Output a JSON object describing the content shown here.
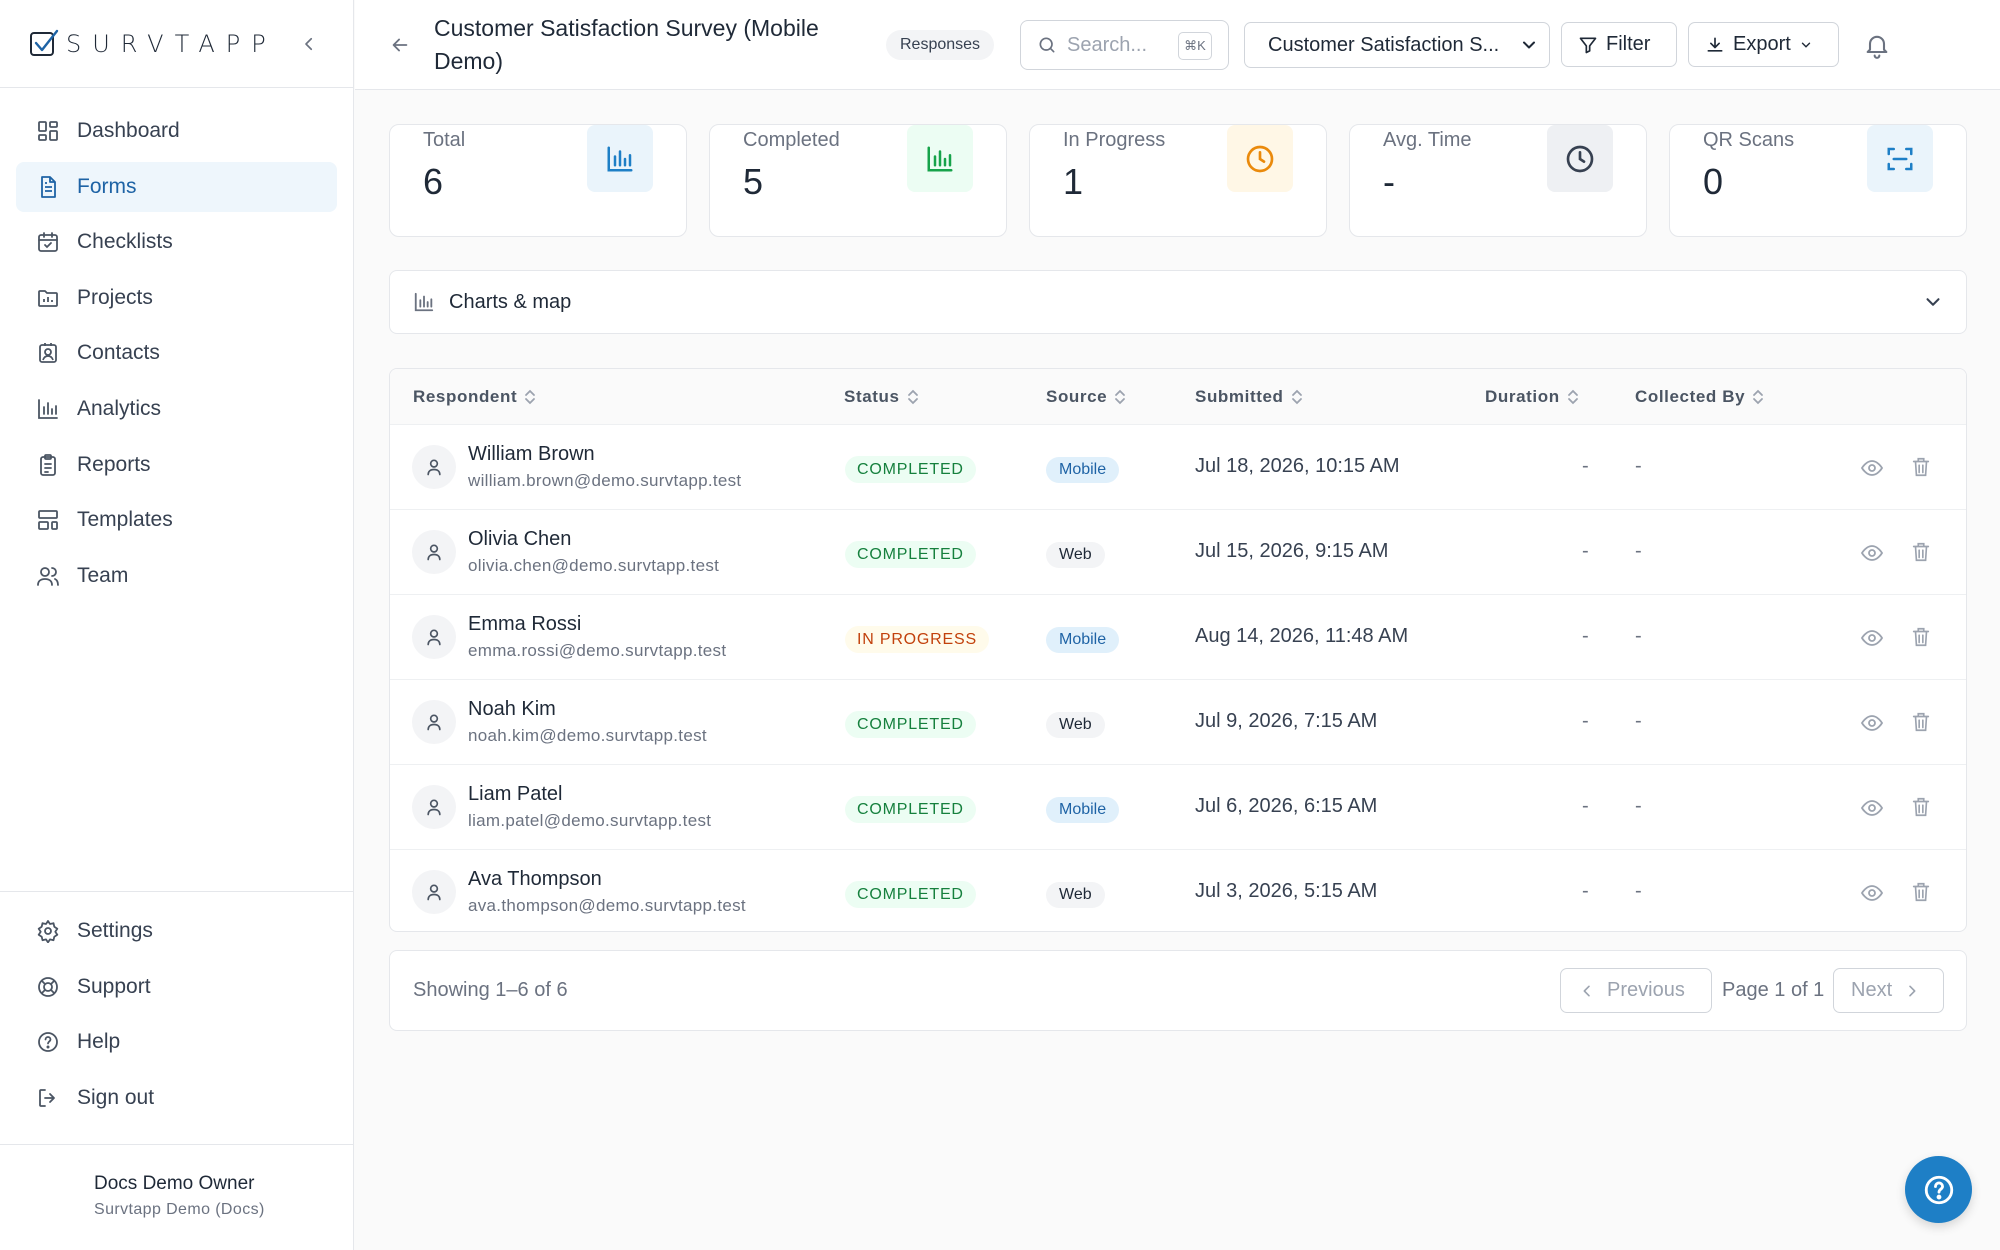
{
  "brand": {
    "name": "SURVTAPP"
  },
  "sidebar": {
    "items": [
      {
        "label": "Dashboard",
        "icon": "dashboard-icon"
      },
      {
        "label": "Forms",
        "icon": "file-text-icon",
        "active": true
      },
      {
        "label": "Checklists",
        "icon": "calendar-check-icon"
      },
      {
        "label": "Projects",
        "icon": "folder-chart-icon"
      },
      {
        "label": "Contacts",
        "icon": "contact-card-icon"
      },
      {
        "label": "Analytics",
        "icon": "bar-chart-icon"
      },
      {
        "label": "Reports",
        "icon": "clipboard-list-icon"
      },
      {
        "label": "Templates",
        "icon": "layout-template-icon"
      },
      {
        "label": "Team",
        "icon": "users-icon"
      }
    ],
    "bottom_items": [
      {
        "label": "Settings",
        "icon": "gear-icon"
      },
      {
        "label": "Support",
        "icon": "lifebuoy-icon"
      },
      {
        "label": "Help",
        "icon": "help-circle-icon"
      },
      {
        "label": "Sign out",
        "icon": "sign-out-icon"
      }
    ],
    "user": {
      "name": "Docs Demo Owner",
      "org": "Survtapp Demo (Docs)"
    }
  },
  "header": {
    "title": "Customer Satisfaction Survey (Mobile Demo)",
    "badge": "Responses",
    "search_placeholder": "Search...",
    "search_shortcut": "⌘K",
    "form_select_value": "Customer Satisfaction S...",
    "filter_label": "Filter",
    "export_label": "Export"
  },
  "stats": [
    {
      "label": "Total",
      "value": "6",
      "icon": "bar-chart-icon",
      "color": "#1e7fc6",
      "bg": "#eaf4fb"
    },
    {
      "label": "Completed",
      "value": "5",
      "icon": "bar-chart-icon",
      "color": "#16a34a",
      "bg": "#ecfdf3"
    },
    {
      "label": "In Progress",
      "value": "1",
      "icon": "clock-icon",
      "color": "#ea8a0c",
      "bg": "#fff7e6"
    },
    {
      "label": "Avg. Time",
      "value": "-",
      "icon": "clock-icon",
      "color": "#374151",
      "bg": "#eef0f3"
    },
    {
      "label": "QR Scans",
      "value": "0",
      "icon": "qr-scan-icon",
      "color": "#1e7fc6",
      "bg": "#eaf4fb"
    }
  ],
  "charts_section": {
    "label": "Charts & map"
  },
  "table": {
    "columns": [
      "Respondent",
      "Status",
      "Source",
      "Submitted",
      "Duration",
      "Collected By"
    ],
    "rows": [
      {
        "name": "William Brown",
        "email": "william.brown@demo.survtapp.test",
        "status": "COMPLETED",
        "source": "Mobile",
        "submitted": "Jul 18, 2026, 10:15 AM",
        "duration": "-",
        "collected_by": "-"
      },
      {
        "name": "Olivia Chen",
        "email": "olivia.chen@demo.survtapp.test",
        "status": "COMPLETED",
        "source": "Web",
        "submitted": "Jul 15, 2026, 9:15 AM",
        "duration": "-",
        "collected_by": "-"
      },
      {
        "name": "Emma Rossi",
        "email": "emma.rossi@demo.survtapp.test",
        "status": "IN PROGRESS",
        "source": "Mobile",
        "submitted": "Aug 14, 2026, 11:48 AM",
        "duration": "-",
        "collected_by": "-"
      },
      {
        "name": "Noah Kim",
        "email": "noah.kim@demo.survtapp.test",
        "status": "COMPLETED",
        "source": "Web",
        "submitted": "Jul 9, 2026, 7:15 AM",
        "duration": "-",
        "collected_by": "-"
      },
      {
        "name": "Liam Patel",
        "email": "liam.patel@demo.survtapp.test",
        "status": "COMPLETED",
        "source": "Mobile",
        "submitted": "Jul 6, 2026, 6:15 AM",
        "duration": "-",
        "collected_by": "-"
      },
      {
        "name": "Ava Thompson",
        "email": "ava.thompson@demo.survtapp.test",
        "status": "COMPLETED",
        "source": "Web",
        "submitted": "Jul 3, 2026, 5:15 AM",
        "duration": "-",
        "collected_by": "-"
      }
    ]
  },
  "pagination": {
    "showing": "Showing 1–6 of 6",
    "previous": "Previous",
    "page_info": "Page 1 of 1",
    "next": "Next"
  }
}
